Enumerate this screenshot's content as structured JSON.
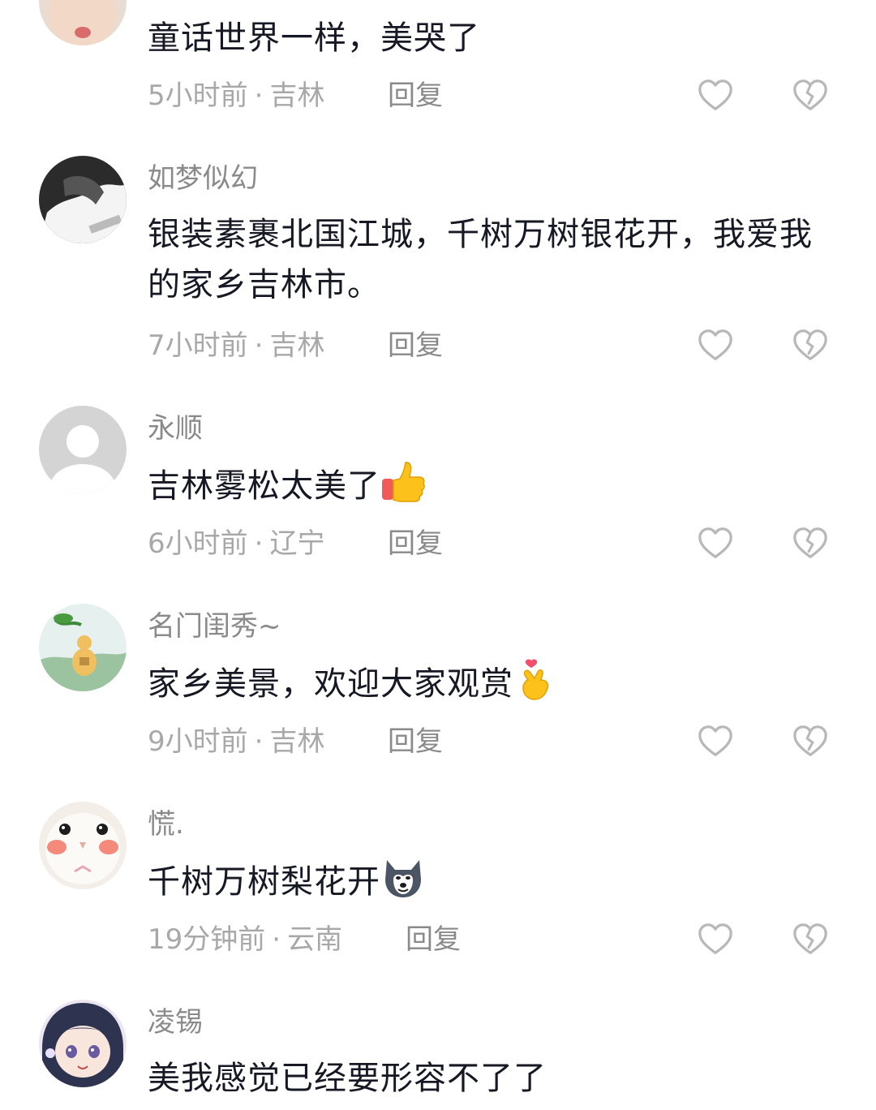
{
  "comments": [
    {
      "username": "",
      "text": "童话世界一样，美哭了",
      "time": "5小时前",
      "location": "吉林",
      "reply_label": "回复",
      "avatar_icon": "kissing-face-avatar",
      "emoji": ""
    },
    {
      "username": "如梦似幻",
      "text": "银装素裹北国江城，千树万树银花开，我爱我的家乡吉林市。",
      "time": "7小时前",
      "location": "吉林",
      "reply_label": "回复",
      "avatar_icon": "dark-photo-avatar",
      "emoji": ""
    },
    {
      "username": "永顺",
      "text": "吉林雾松太美了",
      "time": "6小时前",
      "location": "辽宁",
      "reply_label": "回复",
      "avatar_icon": "default-person-avatar",
      "emoji": "thumbs-up"
    },
    {
      "username": "名门闺秀~",
      "text": "家乡美景，欢迎大家观赏",
      "time": "9小时前",
      "location": "吉林",
      "reply_label": "回复",
      "avatar_icon": "gourd-landscape-avatar",
      "emoji": "finger-heart"
    },
    {
      "username": "慌.",
      "text": "千树万树梨花开",
      "time": "19分钟前",
      "location": "云南",
      "reply_label": "回复",
      "avatar_icon": "white-cat-avatar",
      "emoji": "husky-dog"
    },
    {
      "username": "凌锡",
      "text": "美我感觉已经要形容不了了",
      "time": "",
      "location": "",
      "reply_label": "",
      "avatar_icon": "anime-girl-avatar",
      "emoji": ""
    }
  ],
  "meta_separator": "·",
  "icons": {
    "like": "heart-outline-icon",
    "dislike": "broken-heart-icon"
  },
  "colors": {
    "text": "#161823",
    "username": "#8a8a8a",
    "meta": "#a8a8a8",
    "icon": "#b8b8b8"
  }
}
